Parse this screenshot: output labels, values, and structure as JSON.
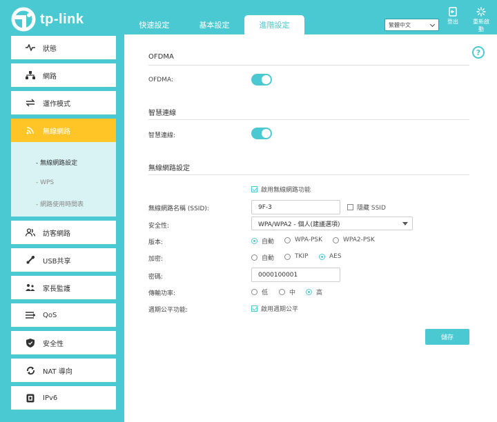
{
  "brand": {
    "name": "tp-link"
  },
  "tabs": [
    {
      "label": "快速設定"
    },
    {
      "label": "基本設定"
    },
    {
      "label": "進階設定"
    }
  ],
  "language": {
    "selected": "繁體中文"
  },
  "header": {
    "logout_label": "登出",
    "reboot_label": "重新啟動"
  },
  "sidebar": {
    "items": [
      {
        "label": "狀態",
        "icon": "pulse-icon"
      },
      {
        "label": "網路",
        "icon": "network-icon"
      },
      {
        "label": "運作模式",
        "icon": "mode-icon"
      },
      {
        "label": "無線網路",
        "icon": "wifi-icon"
      },
      {
        "label": "訪客網路",
        "icon": "guests-icon"
      },
      {
        "label": "USB共享",
        "icon": "usb-icon"
      },
      {
        "label": "家長監護",
        "icon": "family-icon"
      },
      {
        "label": "QoS",
        "icon": "qos-icon"
      },
      {
        "label": "安全性",
        "icon": "shield-icon"
      },
      {
        "label": "NAT 導向",
        "icon": "nat-icon"
      },
      {
        "label": "IPv6",
        "icon": "ipv6-icon"
      }
    ],
    "submenu": [
      {
        "label": "- 無線網路設定"
      },
      {
        "label": "- WPS"
      },
      {
        "label": "- 網路使用時間表"
      }
    ]
  },
  "ofdma": {
    "title": "OFDMA",
    "label": "OFDMA:",
    "enabled": true
  },
  "smart_connect": {
    "title": "智慧連線",
    "label": "智慧連線:",
    "enabled": true
  },
  "wireless": {
    "title": "無線網路設定",
    "enable_label": "啟用無線網路功能",
    "ssid_label": "無線網路名稱 (SSID):",
    "ssid_value": "9F-3",
    "hide_ssid_label": "隱藏 SSID",
    "security_label": "安全性:",
    "security_value": "WPA/WPA2 - 個人(建議選項)",
    "version_label": "版本:",
    "version_options": [
      "自動",
      "WPA-PSK",
      "WPA2-PSK"
    ],
    "encryption_label": "加密:",
    "encryption_options": [
      "自動",
      "TKIP",
      "AES"
    ],
    "password_label": "密碼:",
    "password_value": "0000100001",
    "power_label": "傳輸功率:",
    "power_options": [
      "低",
      "中",
      "高"
    ],
    "airtime_label": "週期公平功能:",
    "airtime_check_label": "啟用週期公平"
  },
  "save_label": "儲存"
}
